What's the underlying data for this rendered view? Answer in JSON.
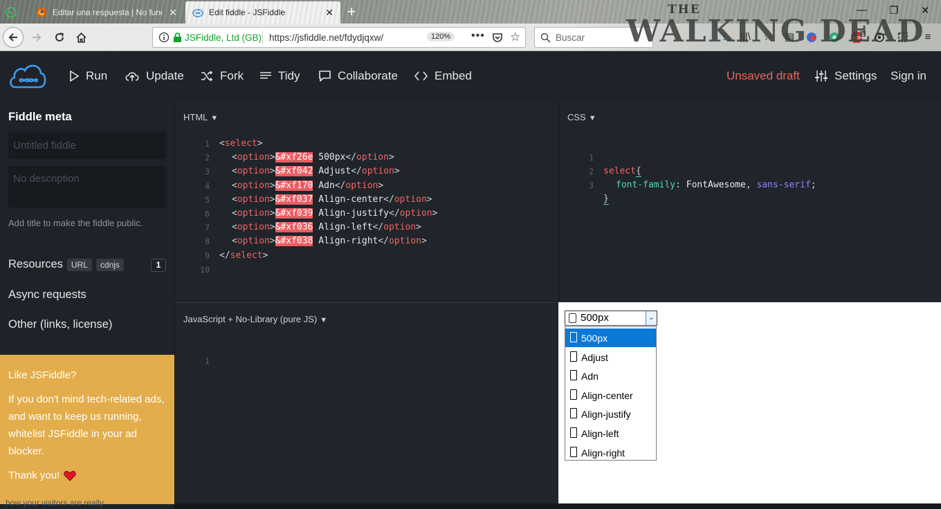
{
  "browser": {
    "tabs": [
      {
        "label": ""
      },
      {
        "label": "Editar una respuesta | No funci"
      },
      {
        "label": "Edit fiddle - JSFiddle",
        "active": true
      }
    ],
    "url_identity": "JSFiddle, Ltd (GB)",
    "url": "https://jsfiddle.net/fdydjqxw/",
    "zoom": "120%",
    "search_placeholder": "Buscar",
    "background_art": {
      "line1": "THE",
      "line2": "WALKING DEAD"
    }
  },
  "header": {
    "run": "Run",
    "update": "Update",
    "fork": "Fork",
    "tidy": "Tidy",
    "collaborate": "Collaborate",
    "embed": "Embed",
    "unsaved": "Unsaved draft",
    "settings": "Settings",
    "signin": "Sign in",
    "unsaved_color": "#f0645a"
  },
  "sidebar": {
    "title": "Fiddle meta",
    "title_placeholder": "Untitled fiddle",
    "description_placeholder": "No description",
    "hint": "Add title to make the fiddle public.",
    "resources": "Resources",
    "resources_tags": [
      "URL",
      "cdnjs"
    ],
    "resources_count": "1",
    "async": "Async requests",
    "other": "Other (links, license)",
    "ad": {
      "title": "Like JSFiddle?",
      "body": "If you don't mind tech-related ads, and want to keep us running, whitelist JSFiddle in your ad blocker.",
      "thanks": "Thank you!",
      "bg_color": "#e3ad4b"
    },
    "footer_text": "how your visitors are really"
  },
  "panels": {
    "html_label": "HTML",
    "css_label": "CSS",
    "js_label": "JavaScript + No-Library (pure JS)",
    "html_lines": [
      {
        "n": "1",
        "open": "select"
      },
      {
        "n": "2",
        "entity": "&#xf26e",
        "text": " 500px"
      },
      {
        "n": "3",
        "entity": "&#xf042",
        "text": " Adjust"
      },
      {
        "n": "4",
        "entity": "&#xf170",
        "text": " Adn"
      },
      {
        "n": "5",
        "entity": "&#xf037",
        "text": " Align-center"
      },
      {
        "n": "6",
        "entity": "&#xf039",
        "text": " Align-justify"
      },
      {
        "n": "7",
        "entity": "&#xf036",
        "text": " Align-left"
      },
      {
        "n": "8",
        "entity": "&#xf038",
        "text": " Align-right"
      },
      {
        "n": "9",
        "close": "select"
      },
      {
        "n": "10"
      }
    ],
    "css": {
      "selector": "select",
      "property": "font-family",
      "value1": "FontAwesome",
      "value2": "sans-serif",
      "line_numbers": [
        "1",
        "2",
        "3"
      ]
    },
    "js_line_numbers": [
      "1"
    ]
  },
  "result": {
    "selected": "500px",
    "options": [
      "500px",
      "Adjust",
      "Adn",
      "Align-center",
      "Align-justify",
      "Align-left",
      "Align-right"
    ],
    "highlight_color": "#0b79d7"
  }
}
